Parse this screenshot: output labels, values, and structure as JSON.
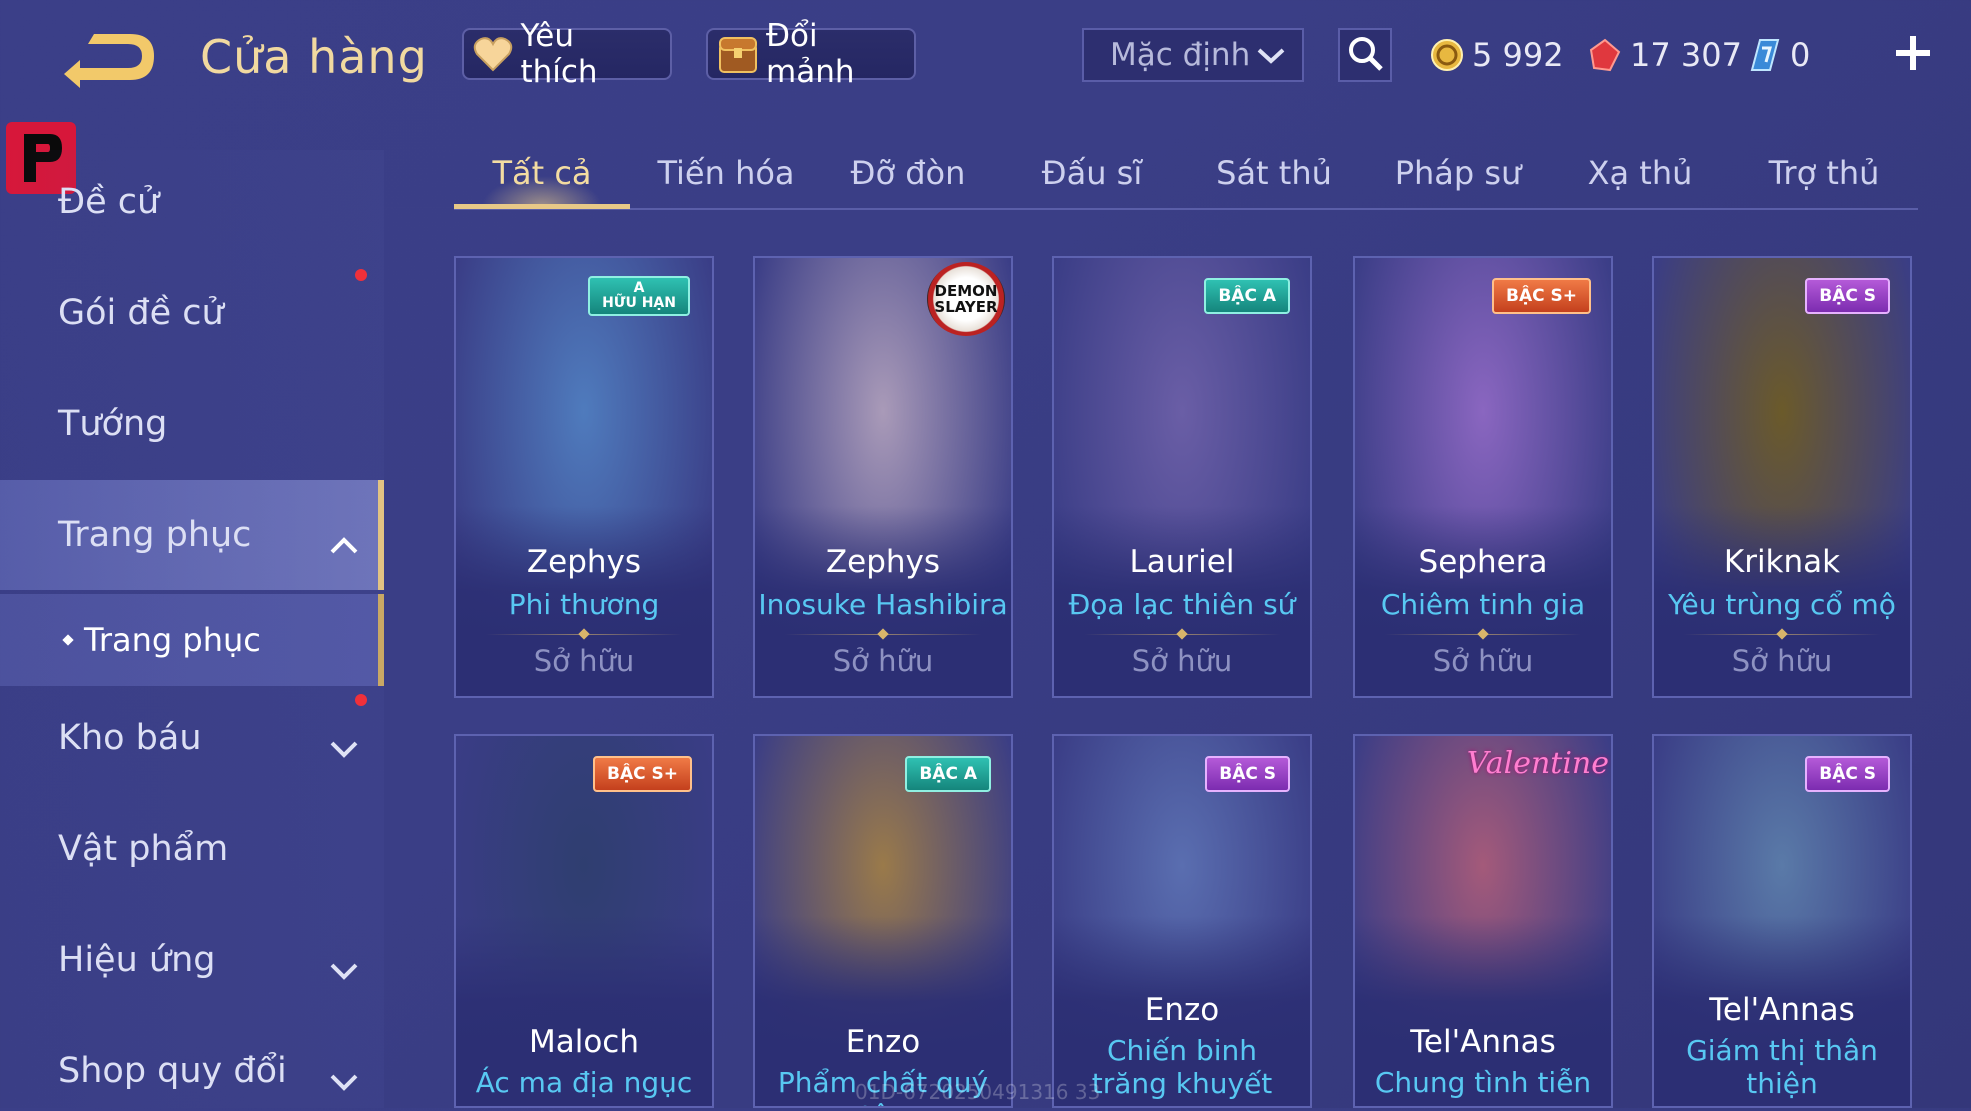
{
  "header": {
    "title": "Cửa hàng",
    "favorites_label": "Yêu thích",
    "exchange_label": "Đổi mảnh",
    "sort_value": "Mặc định",
    "gold": "5 992",
    "vouchers": "17 307",
    "quan_huy": "0"
  },
  "sidebar": {
    "items": [
      {
        "label": "Đề cử"
      },
      {
        "label": "Gói đề cử"
      },
      {
        "label": "Tướng"
      },
      {
        "label": "Trang phục"
      },
      {
        "label": "Kho báu"
      },
      {
        "label": "Vật phẩm"
      },
      {
        "label": "Hiệu ứng"
      },
      {
        "label": "Shop quy đổi"
      }
    ],
    "sub_item": "Trang phục"
  },
  "tabs": [
    "Tất cả",
    "Tiến hóa",
    "Đỡ đòn",
    "Đấu sĩ",
    "Sát thủ",
    "Pháp sư",
    "Xạ thủ",
    "Trợ thủ"
  ],
  "active_tab": "Tất cả",
  "cards": [
    {
      "hero": "Zephys",
      "skin": "Phi thương",
      "status": "Sở hữu",
      "badge": "A",
      "badge_sub": "HỮU HẠN",
      "art_color": "#4f7bbd"
    },
    {
      "hero": "Zephys",
      "skin": "Inosuke Hashibira",
      "status": "Sở hữu",
      "badge": "DEMON SLAYER",
      "art_color": "#a99ab8"
    },
    {
      "hero": "Lauriel",
      "skin": "Đọa lạc thiên sứ",
      "status": "Sở hữu",
      "badge": "BẬC A",
      "art_color": "#6a5ea6"
    },
    {
      "hero": "Sephera",
      "skin": "Chiêm tinh gia",
      "status": "Sở hữu",
      "badge": "BẬC S+",
      "art_color": "#8a66c0"
    },
    {
      "hero": "Kriknak",
      "skin": "Yêu trùng cổ mộ",
      "status": "Sở hữu",
      "badge": "BẬC S",
      "art_color": "#6b5a2a"
    },
    {
      "hero": "Maloch",
      "skin": "Ác ma địa ngục",
      "badge": "BẬC S+",
      "art_color": "#2f3e70"
    },
    {
      "hero": "Enzo",
      "skin": "Phẩm chất quý tộc",
      "badge": "BẬC A",
      "art_color": "#9a7a4a"
    },
    {
      "hero": "Enzo",
      "skin": "Chiến binh trăng khuyết",
      "badge": "BẬC S",
      "art_color": "#5a6eb0"
    },
    {
      "hero": "Tel'Annas",
      "skin": "Chung tình tiễn",
      "badge": "Valentine",
      "art_color": "#a45a7a"
    },
    {
      "hero": "Tel'Annas",
      "skin": "Giám thị thân thiện",
      "badge": "BẬC S",
      "art_color": "#5a7aa8"
    }
  ],
  "watermark": "01D-6720250491316 33"
}
